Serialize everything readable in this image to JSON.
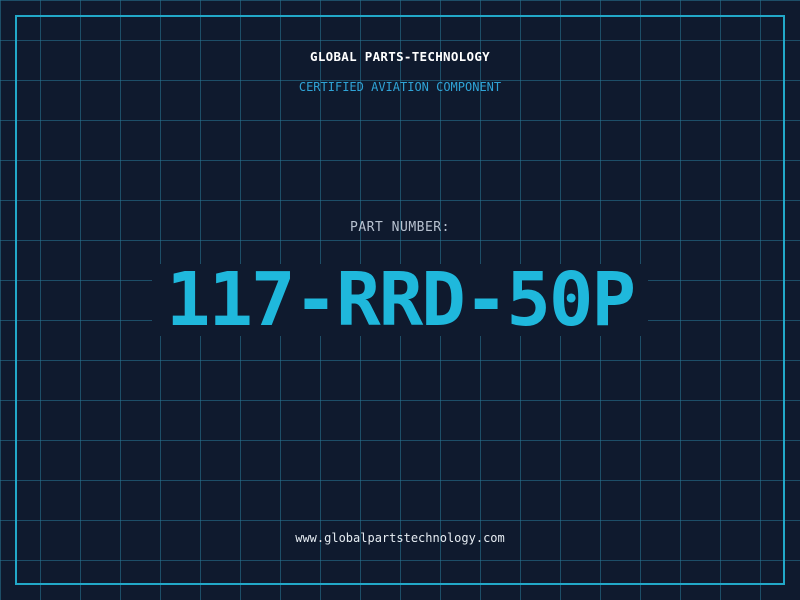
{
  "header": {
    "company": "GLOBAL PARTS-TECHNOLOGY",
    "tagline": "CERTIFIED AVIATION COMPONENT"
  },
  "part": {
    "label": "PART NUMBER:",
    "number": "117-RRD-50P"
  },
  "footer": {
    "website": "www.globalpartstechnology.com"
  },
  "colors": {
    "background": "#0f1a2e",
    "grid": "#287896",
    "accent": "#22a8c8",
    "part_number": "#1fb8dc"
  }
}
